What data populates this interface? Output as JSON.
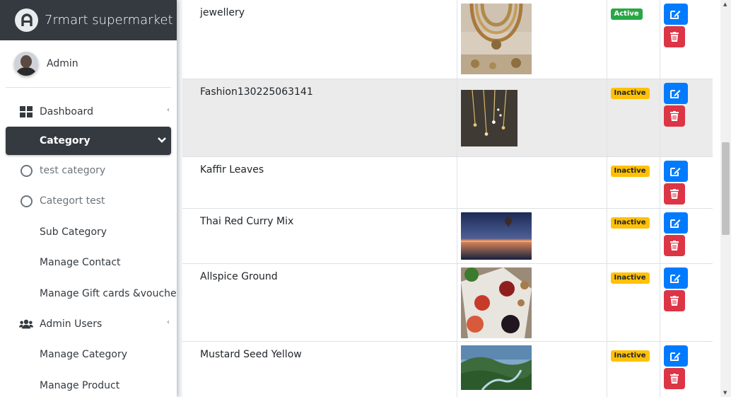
{
  "brand": {
    "title": "7rmart supermarket"
  },
  "user": {
    "name": "Admin"
  },
  "sidebar": {
    "items": [
      {
        "label": "Dashboard",
        "icon": "dashboard-grid-icon"
      },
      {
        "label": "Category",
        "icon": "chevron-down-icon"
      },
      {
        "label": "test category",
        "icon": "circle-icon"
      },
      {
        "label": "Categort test",
        "icon": "circle-icon"
      },
      {
        "label": "Sub Category"
      },
      {
        "label": "Manage Contact"
      },
      {
        "label": "Manage Gift cards &voucher"
      },
      {
        "label": "Admin Users",
        "icon": "users-icon"
      },
      {
        "label": "Manage Category"
      },
      {
        "label": "Manage Product"
      }
    ]
  },
  "table": {
    "rows": [
      {
        "name": "jewellery",
        "image": "jewellery-necklace-photo",
        "status": "Active"
      },
      {
        "name": "Fashion130225063141",
        "image": "gold-chains-photo",
        "status": "Inactive"
      },
      {
        "name": "Kaffir Leaves",
        "image": "",
        "status": "Inactive"
      },
      {
        "name": "Thai Red Curry Mix",
        "image": "hot-air-balloon-sunset-photo",
        "status": "Inactive"
      },
      {
        "name": "Allspice Ground",
        "image": "apples-and-nuts-photo",
        "status": "Inactive"
      },
      {
        "name": "Mustard Seed Yellow",
        "image": "green-valley-landscape-photo",
        "status": "Inactive"
      }
    ]
  },
  "colors": {
    "brand_bg": "#343a40",
    "active_badge": "#28a745",
    "inactive_badge": "#ffc107",
    "edit_button": "#007bff",
    "delete_button": "#dc3545"
  }
}
